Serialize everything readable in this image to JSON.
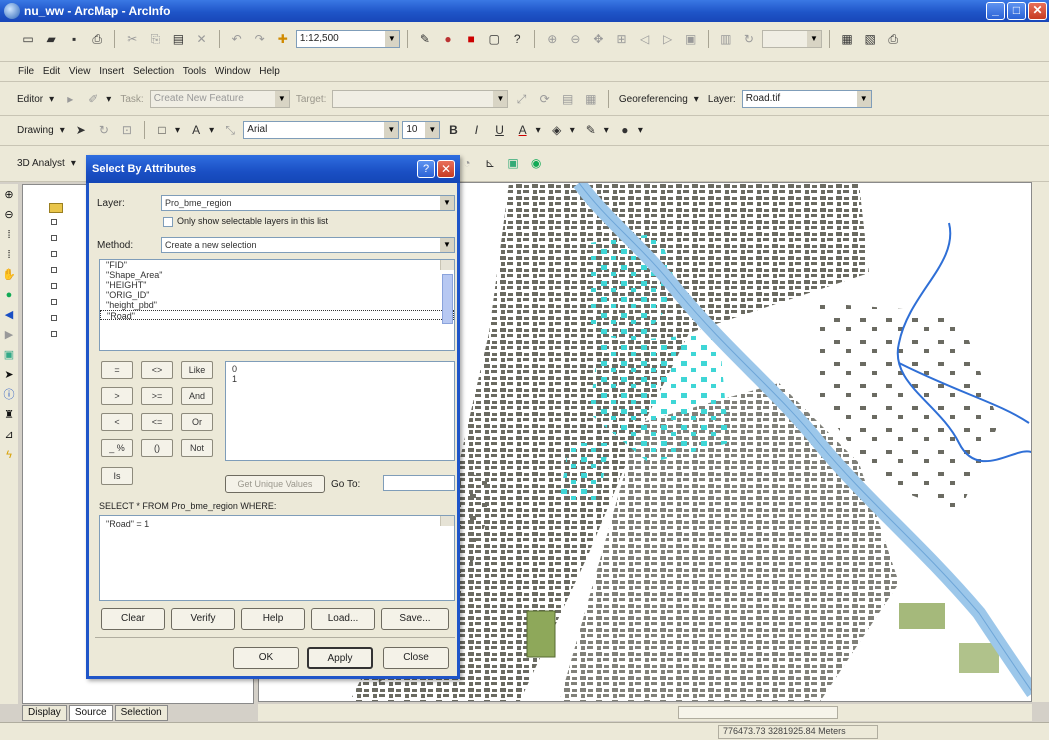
{
  "app": {
    "title": "nu_ww - ArcMap - ArcInfo",
    "accent": "#1f55c8"
  },
  "menubar": {
    "items": [
      "File",
      "Edit",
      "View",
      "Insert",
      "Selection",
      "Tools",
      "Window",
      "Help"
    ]
  },
  "toolbar_standard": {
    "scale_value": "1:12,500"
  },
  "toolbar_editor": {
    "editor_label": "Editor",
    "task_label": "Task:",
    "task_value": "Create New Feature",
    "target_label": "Target:",
    "target_value": "",
    "georef_label": "Georeferencing",
    "layer_label": "Layer:",
    "layer_value": "Road.tif"
  },
  "toolbar_draw": {
    "drawing_label": "Drawing",
    "font_value": "Arial",
    "size_value": "10"
  },
  "toolbar_spatial": {
    "label": "3D Analyst"
  },
  "toc": {
    "tabs": [
      "Display",
      "Source",
      "Selection"
    ]
  },
  "dialog": {
    "title": "Select By Attributes",
    "layer_label": "Layer:",
    "layer_value": "Pro_bme_region",
    "only_selectable_label": "Only show selectable layers in this list",
    "method_label": "Method:",
    "method_value": "Create a new selection",
    "fields": [
      "\"FID\"",
      "\"Shape_Area\"",
      "\"HEIGHT\"",
      "\"ORIG_ID\"",
      "\"height_pbd\"",
      "\"Road\""
    ],
    "unique_values": [
      "0",
      "1"
    ],
    "operators": [
      [
        "=",
        "<>",
        "Like"
      ],
      [
        ">",
        ">=",
        "And"
      ],
      [
        "<",
        "<=",
        "Or"
      ],
      [
        "_ %",
        "()",
        "Not"
      ]
    ],
    "is_label": "Is",
    "get_unique_label": "Get Unique Values",
    "goto_label": "Go To:",
    "sql_prefix": "SELECT * FROM Pro_bme_region WHERE:",
    "expression": "\"Road\" = 1",
    "buttons_row1": [
      "Clear",
      "Verify",
      "Help",
      "Load...",
      "Save..."
    ],
    "buttons_row2": [
      "OK",
      "Apply",
      "Close"
    ]
  },
  "status": {
    "coordinates": "776473.73  3281925.84 Meters"
  },
  "colors": {
    "selection": "#3fd6d6",
    "buildings": "#6b6b62",
    "river": "#9cc7ea",
    "parcels": "#8ea85a"
  }
}
